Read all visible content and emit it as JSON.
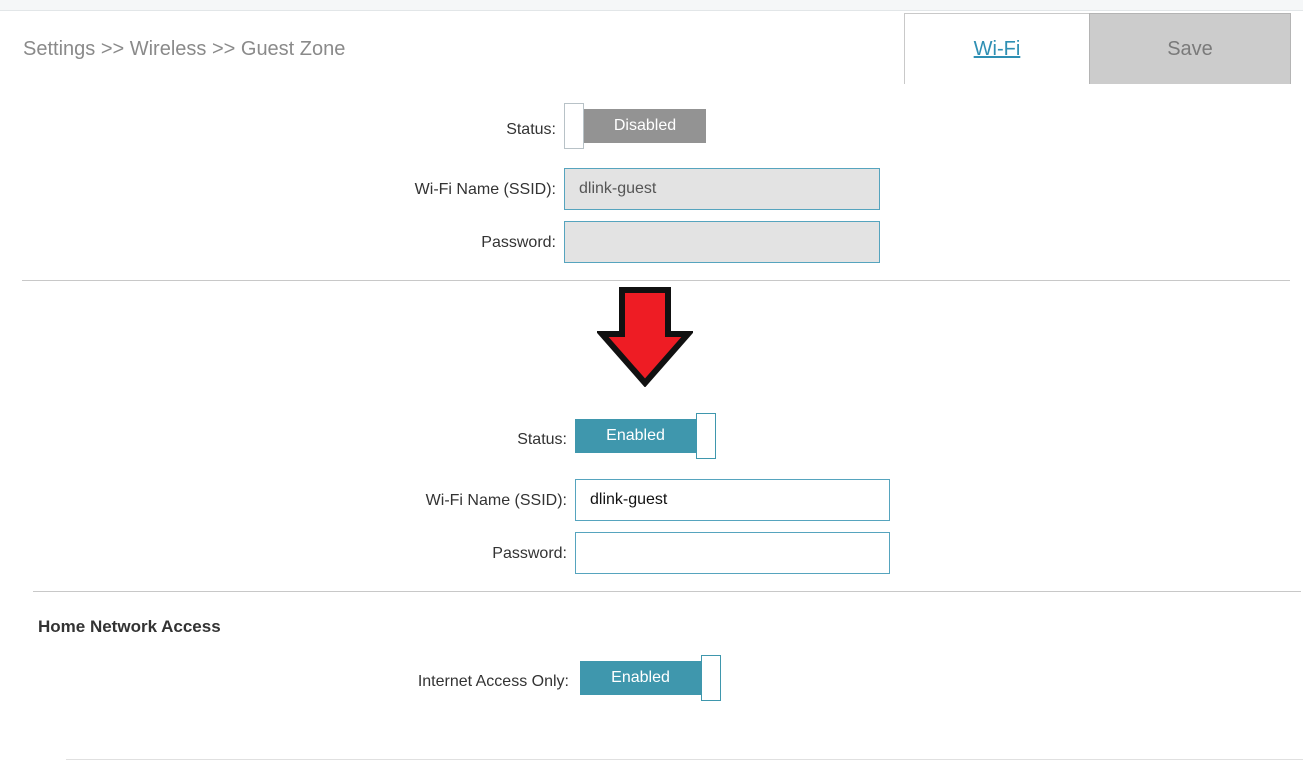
{
  "header": {
    "breadcrumb": "Settings >> Wireless >> Guest Zone",
    "wifi_tab": "Wi-Fi",
    "save_label": "Save"
  },
  "before": {
    "status_label": "Status:",
    "status_value": "Disabled",
    "ssid_label": "Wi-Fi Name (SSID):",
    "ssid_value": "dlink-guest",
    "password_label": "Password:",
    "password_value": ""
  },
  "after": {
    "status_label": "Status:",
    "status_value": "Enabled",
    "ssid_label": "Wi-Fi Name (SSID):",
    "ssid_value": "dlink-guest",
    "password_label": "Password:",
    "password_value": ""
  },
  "home_network": {
    "title": "Home Network Access",
    "internet_only_label": "Internet Access Only:",
    "internet_only_value": "Enabled"
  },
  "icons": {
    "transition_arrow": "arrow-down-icon"
  },
  "colors": {
    "accent": "#3f97ad",
    "link": "#2f8fb3",
    "disabled_toggle": "#939393",
    "arrow_fill": "#ee1c24"
  }
}
